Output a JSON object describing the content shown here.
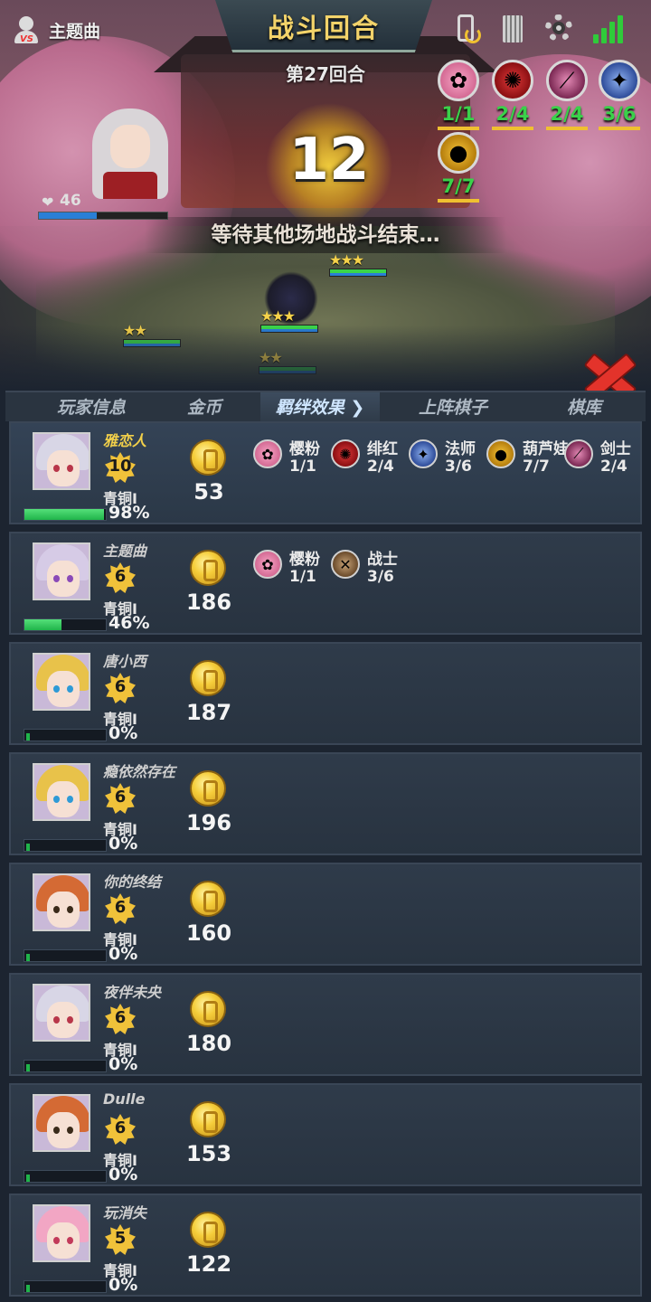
{
  "topbar": {
    "player_name": "主题曲",
    "title": "战斗回合",
    "round": "第27回合",
    "countdown": "12",
    "status": "等待其他场地战斗结束…",
    "icons": [
      "vs-player-icon",
      "sync-phone-icon",
      "card-book-icon",
      "gear-icon",
      "signal-icon"
    ]
  },
  "enemy": {
    "hp": "46",
    "hp_fraction": 0.45
  },
  "field_synergies": [
    {
      "icon": "sakura-icon",
      "count": "1/1"
    },
    {
      "icon": "crimson-icon",
      "count": "2/4"
    },
    {
      "icon": "swordsman-icon",
      "count": "2/4"
    },
    {
      "icon": "mage-icon",
      "count": "3/6"
    },
    {
      "icon": "gourd-icon",
      "count": "7/7"
    }
  ],
  "tabs": [
    {
      "label": "玩家信息",
      "active": false
    },
    {
      "label": "金币",
      "active": false
    },
    {
      "label": "羁绊效果 ❯",
      "active": true
    },
    {
      "label": "上阵棋子",
      "active": false
    },
    {
      "label": "棋库",
      "active": false
    }
  ],
  "players": [
    {
      "name": "雅恋人",
      "level": "10",
      "rank": "青铜I",
      "xp": "98%",
      "xp_fraction": 0.98,
      "gold": "53",
      "self": true,
      "synergies": [
        {
          "icon": "sakura-icon",
          "label": "樱粉",
          "count": "1/1"
        },
        {
          "icon": "crimson-icon",
          "label": "绯红",
          "count": "2/4"
        },
        {
          "icon": "mage-icon",
          "label": "法师",
          "count": "3/6"
        },
        {
          "icon": "gourd-icon",
          "label": "葫芦娃",
          "count": "7/7"
        },
        {
          "icon": "swordsman-icon",
          "label": "剑士",
          "count": "2/4"
        }
      ]
    },
    {
      "name": "主题曲",
      "level": "6",
      "rank": "青铜I",
      "xp": "46%",
      "xp_fraction": 0.46,
      "gold": "186",
      "self": false,
      "synergies": [
        {
          "icon": "sakura-icon",
          "label": "樱粉",
          "count": "1/1"
        },
        {
          "icon": "warrior-icon",
          "label": "战士",
          "count": "3/6"
        }
      ]
    },
    {
      "name": "唐小西",
      "level": "6",
      "rank": "青铜I",
      "xp": "0%",
      "xp_fraction": 0,
      "gold": "187",
      "self": false,
      "synergies": []
    },
    {
      "name": "瘾依然存在",
      "level": "6",
      "rank": "青铜I",
      "xp": "0%",
      "xp_fraction": 0,
      "gold": "196",
      "self": false,
      "synergies": []
    },
    {
      "name": "你的终结",
      "level": "6",
      "rank": "青铜I",
      "xp": "0%",
      "xp_fraction": 0,
      "gold": "160",
      "self": false,
      "synergies": []
    },
    {
      "name": "夜伴未央",
      "level": "6",
      "rank": "青铜I",
      "xp": "0%",
      "xp_fraction": 0,
      "gold": "180",
      "self": false,
      "synergies": []
    },
    {
      "name": "Dulle",
      "level": "6",
      "rank": "青铜I",
      "xp": "0%",
      "xp_fraction": 0,
      "gold": "153",
      "self": false,
      "synergies": []
    },
    {
      "name": "玩消失",
      "level": "5",
      "rank": "青铜I",
      "xp": "0%",
      "xp_fraction": 0,
      "gold": "122",
      "self": false,
      "synergies": []
    }
  ],
  "colors": {
    "accent_gold": "#f3d36a",
    "xp_green": "#20b44a",
    "count_green": "#3ad14a",
    "close_red": "#e3332b"
  }
}
